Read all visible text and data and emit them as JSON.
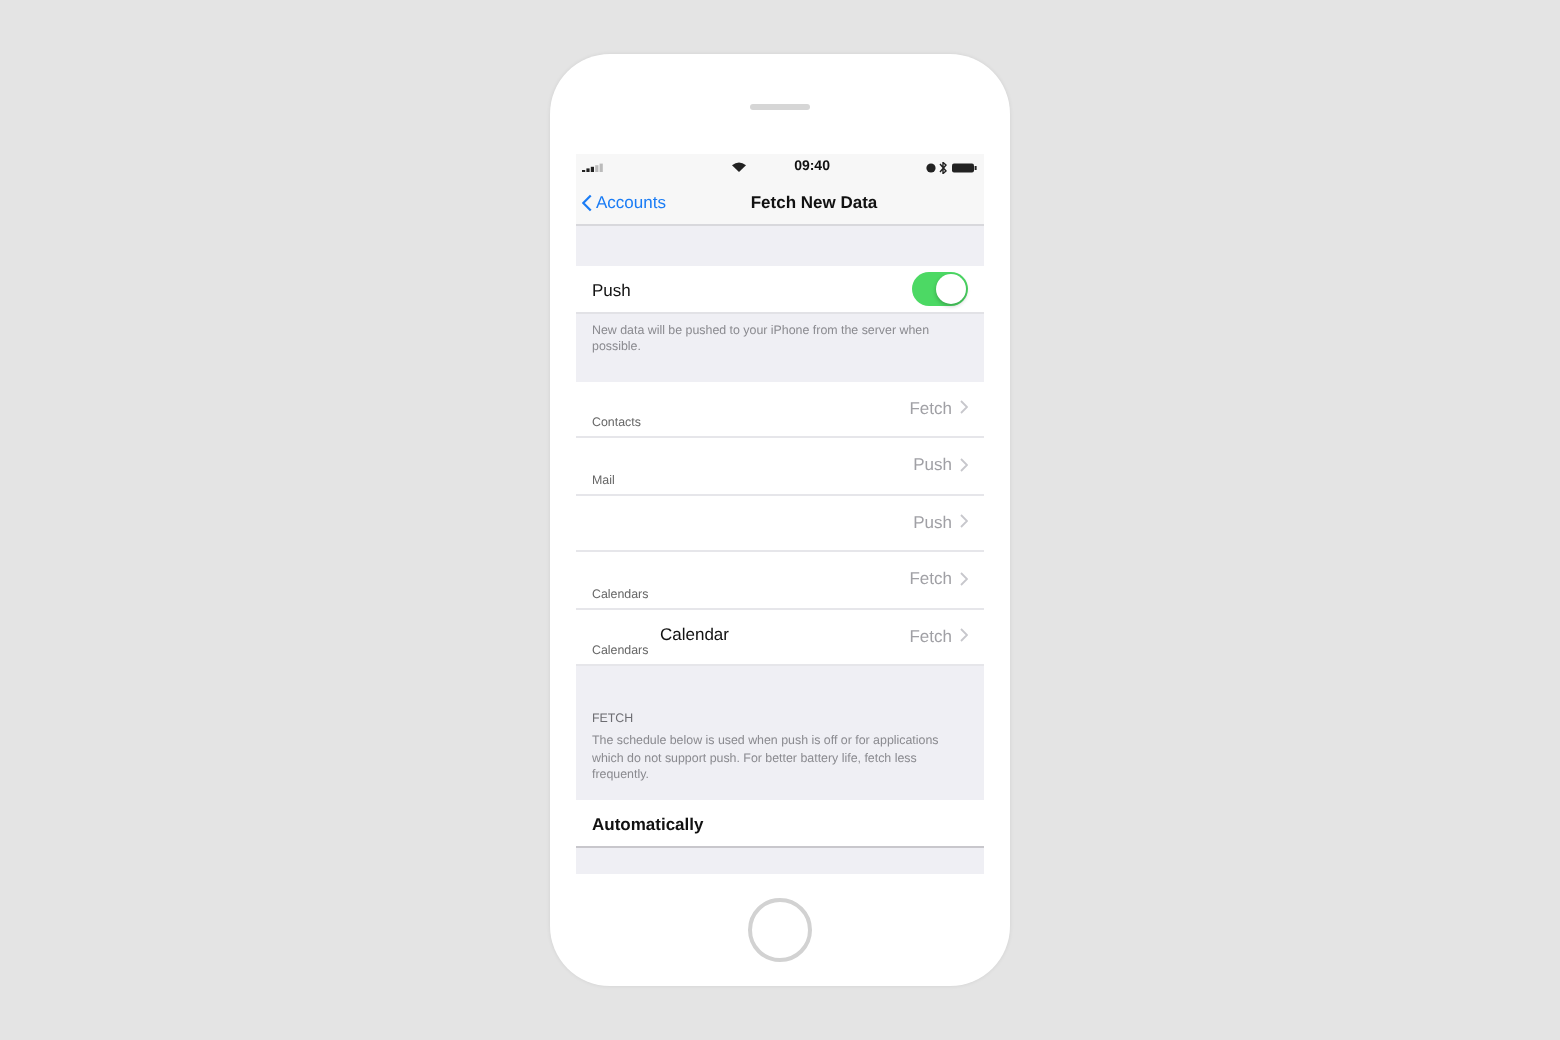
{
  "status_bar": {
    "time": "09:40"
  },
  "nav_bar": {
    "back": "Accounts",
    "title": "Fetch New Data"
  },
  "push": {
    "label": "Push",
    "on": true,
    "footer": "New data will be pushed to your iPhone from the server when possible."
  },
  "accounts": [
    {
      "subtitle": "Contacts",
      "value": "Fetch"
    },
    {
      "subtitle": "Mail",
      "value": "Push"
    },
    {
      "value": "Push"
    },
    {
      "subtitle": "Calendars",
      "value": "Fetch"
    },
    {
      "title": "Calendar",
      "subtitle": "Calendars",
      "value": "Fetch"
    }
  ],
  "fetch": {
    "header": "FETCH",
    "footer": "The schedule below is used when push is off or for applications which do not support push. For better battery life, fetch less frequently.",
    "options": [
      {
        "label": "Automatically"
      }
    ]
  }
}
